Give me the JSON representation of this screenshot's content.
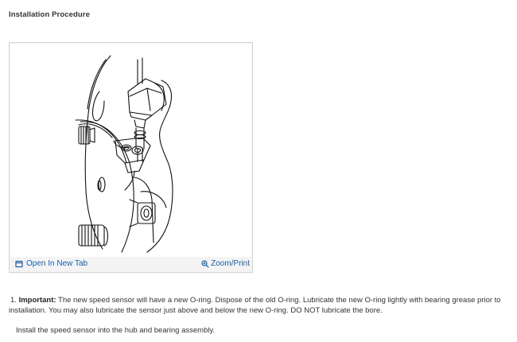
{
  "section": {
    "title": "Installation Procedure"
  },
  "figure": {
    "open_label": "Open In New Tab",
    "open_icon": "open-in-new-tab-icon",
    "zoom_label": "Zoom/Print",
    "zoom_icon": "magnifier-icon",
    "link_color": "#1a5fa8"
  },
  "steps": [
    {
      "number": "1.",
      "important_label": "Important:",
      "text": "The new speed sensor will have a new O-ring. Dispose of the old O-ring. Lubricate the new O-ring lightly with bearing grease prior to installation. You may also lubricate the sensor just above and below the new O-ring. DO NOT lubricate the bore."
    },
    {
      "text": "Install the speed sensor into the hub and bearing assembly."
    }
  ]
}
